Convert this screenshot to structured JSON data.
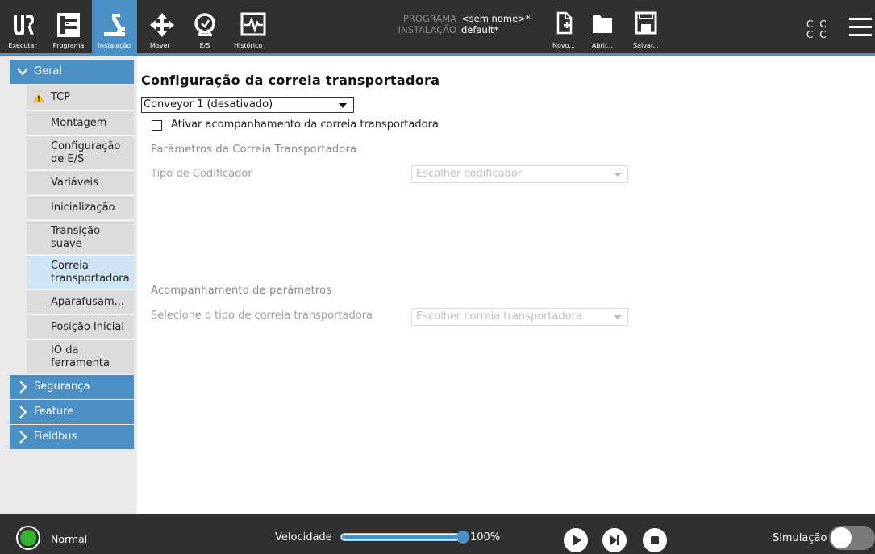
{
  "topbar": {
    "buttons": [
      {
        "label": "Executar"
      },
      {
        "label": "Programa"
      },
      {
        "label": "Instalação"
      },
      {
        "label": "Mover"
      },
      {
        "label": "E/S"
      },
      {
        "label": "Histórico"
      }
    ],
    "program_key": "PROGRAMA",
    "program_value": "<sem nome>*",
    "installation_key": "INSTALAÇÃO",
    "installation_value": "default*",
    "file_buttons": [
      {
        "label": "Novo..."
      },
      {
        "label": "Abrir..."
      },
      {
        "label": "Salvar..."
      }
    ],
    "cc_line1": "C C",
    "cc_line2": "C C",
    "accent_color": "#4a90c4"
  },
  "sidebar": {
    "categories": [
      {
        "label": "Geral",
        "expanded": true
      },
      {
        "label": "Segurança",
        "expanded": false
      },
      {
        "label": "Feature",
        "expanded": false
      },
      {
        "label": "Fieldbus",
        "expanded": false
      }
    ],
    "items": [
      {
        "label": "TCP",
        "warning": true
      },
      {
        "label": "Montagem"
      },
      {
        "label": "Configuração de E/S"
      },
      {
        "label": "Variáveis"
      },
      {
        "label": "Inicialização"
      },
      {
        "label": "Transição suave"
      },
      {
        "label": "Correia transportadora",
        "selected": true
      },
      {
        "label": "Aparafusam..."
      },
      {
        "label": "Posição Inicial"
      },
      {
        "label": "IO da ferramenta"
      }
    ]
  },
  "main": {
    "title": "Configuração da correia transportadora",
    "conveyor_select": "Conveyor 1 (desativado)",
    "tracking_checkbox_label": "Ativar acompanhamento da correia transportadora",
    "tracking_checked": false,
    "params_title": "Parâmetros da Correia Transportadora",
    "encoder_label": "Tipo de Codificador",
    "encoder_placeholder": "Escolher codificador",
    "tracking_title": "Acompanhamento de parâmetros",
    "conveyor_type_label": "Selecione o tipo de correia transportadora",
    "conveyor_type_placeholder": "Escolher correia transportadora"
  },
  "footer": {
    "status": "Normal",
    "status_color": "#2fb52f",
    "speed_label": "Velocidade",
    "speed_value": "100%",
    "speed_fraction": 1.0,
    "simulation_label": "Simulação",
    "simulation_on": false
  }
}
